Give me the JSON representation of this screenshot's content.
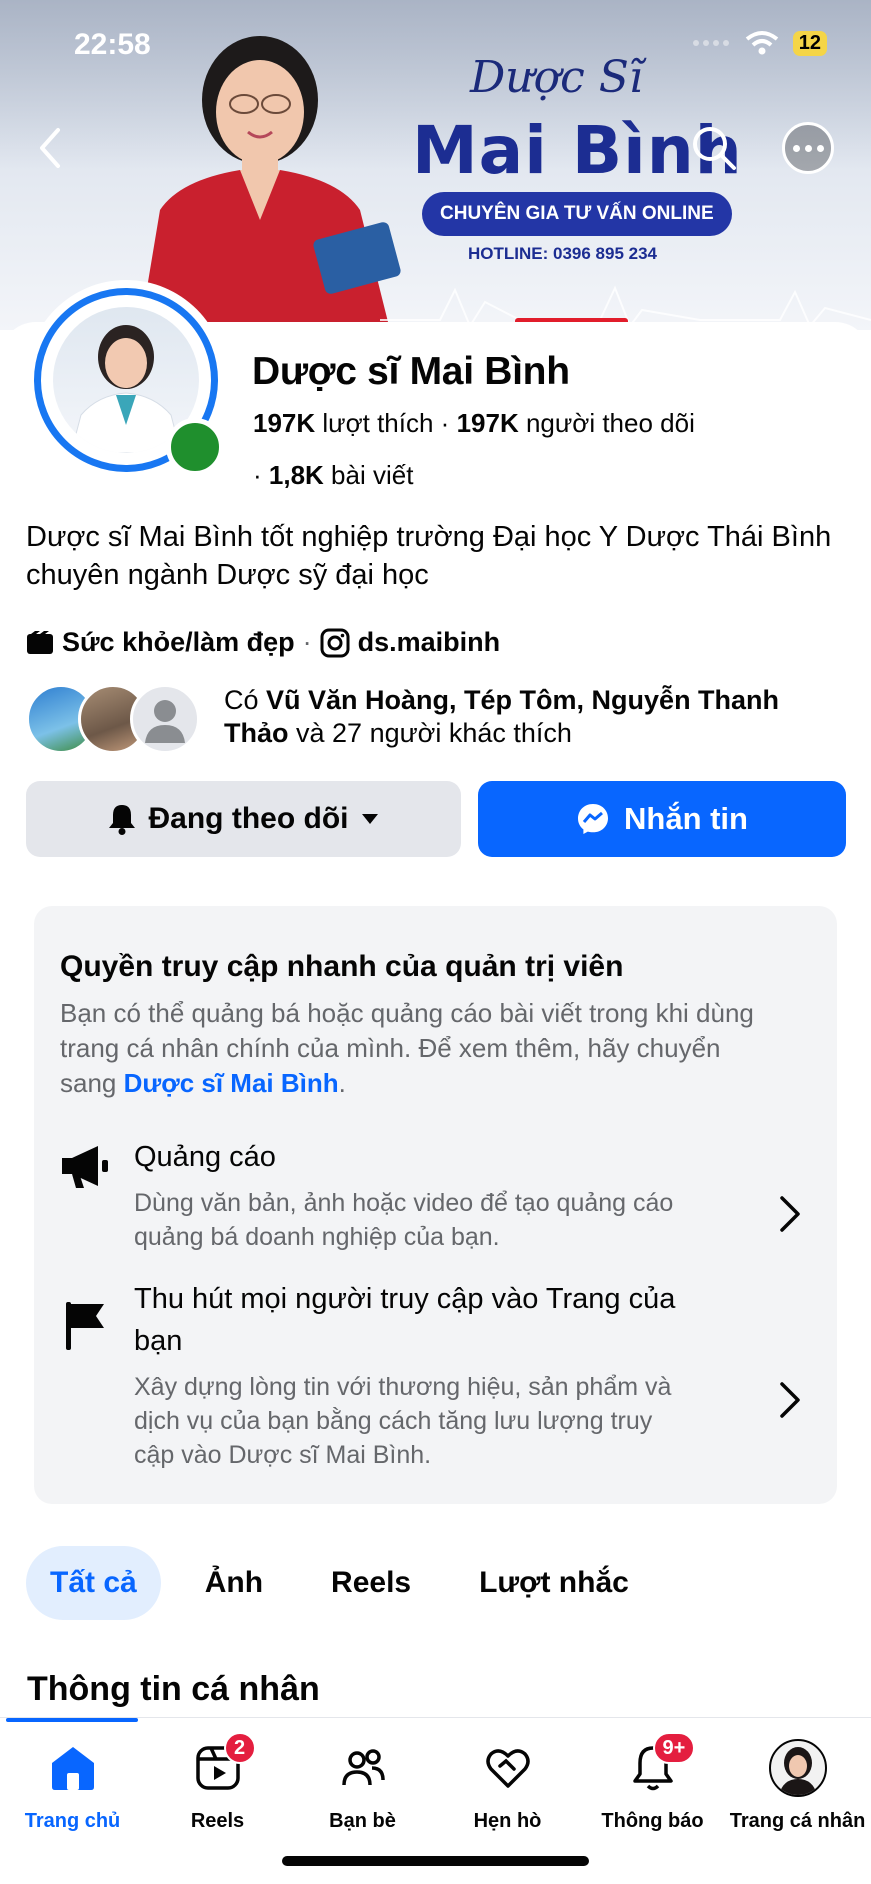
{
  "status_bar": {
    "time": "22:58",
    "battery": "12"
  },
  "cover": {
    "script_text": "Dược Sĩ",
    "name_text": "Mai Bình",
    "pill_text": "CHUYÊN GIA TƯ VẤN ONLINE",
    "hotline_text": "HOTLINE: 0396 895 234"
  },
  "profile": {
    "name": "Dược sĩ Mai Bình",
    "likes_count": "197K",
    "likes_label": "lượt thích",
    "followers_count": "197K",
    "followers_label": "người theo dõi",
    "posts_count": "1,8K",
    "posts_label": "bài viết",
    "bio": "Dược sĩ Mai Bình tốt nghiệp trường Đại học Y Dược Thái Bình chuyên ngành Dược sỹ đại học",
    "category": "Sức khỏe/làm đẹp",
    "instagram": "ds.maibinh",
    "friends_prefix": "Có",
    "friends_names": "Vũ Văn Hoàng, Tép Tôm, Nguyễn Thanh Thảo",
    "friends_suffix": "và 27 người khác thích"
  },
  "actions": {
    "follow_label": "Đang theo dõi",
    "message_label": "Nhắn tin"
  },
  "admin": {
    "title": "Quyền truy cập nhanh của quản trị viên",
    "desc_prefix": "Bạn có thể quảng bá hoặc quảng cáo bài viết trong khi dùng trang cá nhân chính của mình. Để xem thêm, hãy chuyển sang",
    "desc_link": "Dược sĩ Mai Bình",
    "desc_suffix": ".",
    "items": [
      {
        "title": "Quảng cáo",
        "desc": "Dùng văn bản, ảnh hoặc video để tạo quảng cáo quảng bá doanh nghiệp của bạn."
      },
      {
        "title": "Thu hút mọi người truy cập vào Trang của bạn",
        "desc": "Xây dựng lòng tin với thương hiệu, sản phẩm và dịch vụ của bạn bằng cách tăng lưu lượng truy cập vào Dược sĩ Mai Bình."
      }
    ]
  },
  "tabs": [
    {
      "label": "Tất cả",
      "active": true
    },
    {
      "label": "Ảnh",
      "active": false
    },
    {
      "label": "Reels",
      "active": false
    },
    {
      "label": "Lượt nhắc",
      "active": false
    }
  ],
  "section_title": "Thông tin cá nhân",
  "bottom_nav": [
    {
      "label": "Trang chủ",
      "icon": "home-icon",
      "badge": ""
    },
    {
      "label": "Reels",
      "icon": "reels-icon",
      "badge": "2"
    },
    {
      "label": "Bạn bè",
      "icon": "friends-icon",
      "badge": ""
    },
    {
      "label": "Hẹn hò",
      "icon": "dating-icon",
      "badge": ""
    },
    {
      "label": "Thông báo",
      "icon": "bell-icon",
      "badge": "9+"
    },
    {
      "label": "Trang cá nhân",
      "icon": "profile-avatar",
      "badge": ""
    }
  ],
  "colors": {
    "accent": "#0866ff",
    "online": "#1f8f2d",
    "badge": "#e41e3f"
  }
}
